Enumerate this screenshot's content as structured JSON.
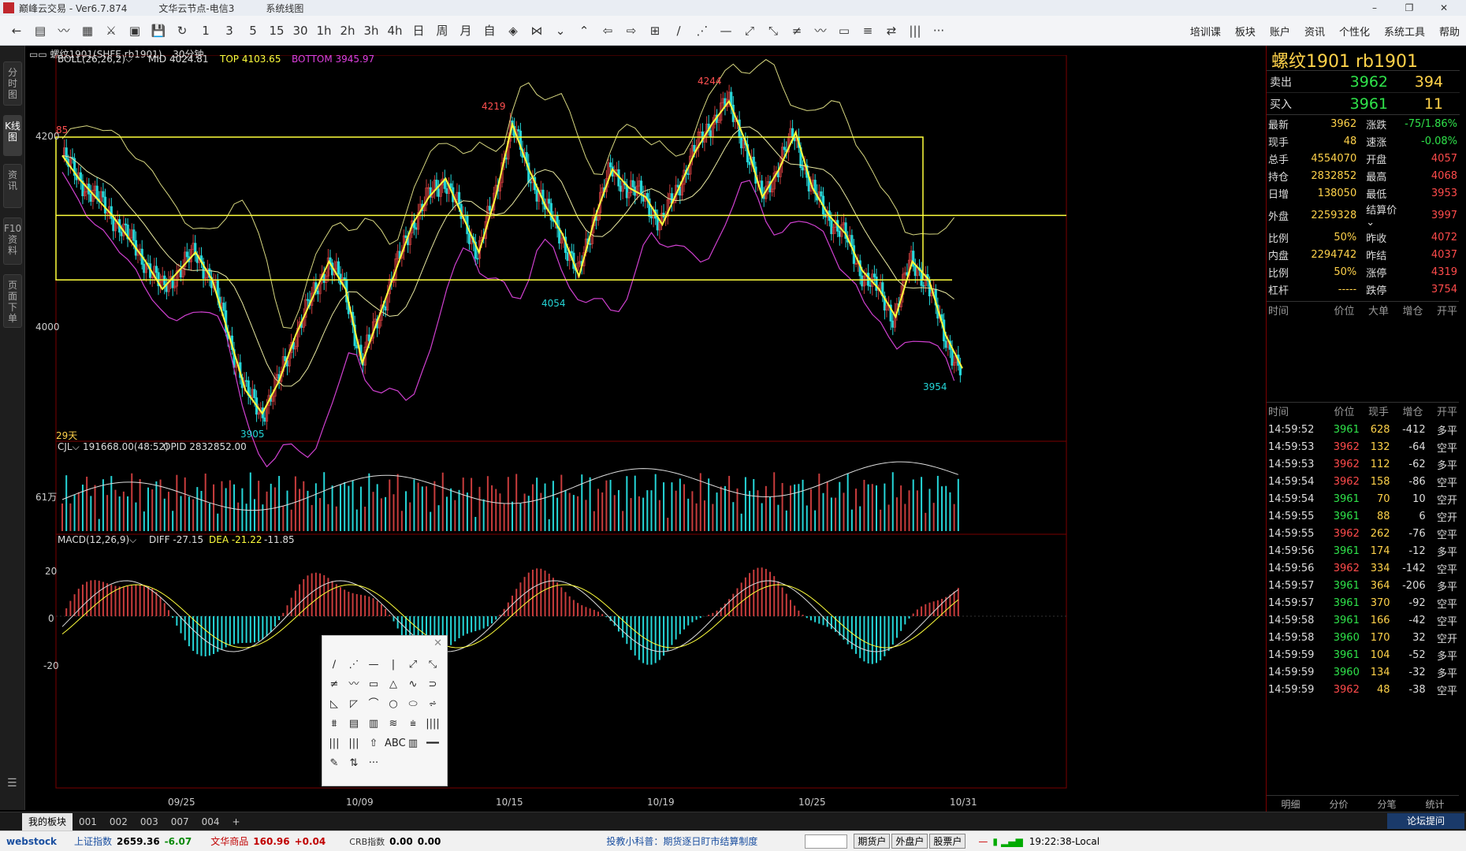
{
  "window": {
    "title": "巅峰云交易 - Ver6.7.874",
    "server": "文华云节点-电信3",
    "mode": "系统线图",
    "controls": [
      "–",
      "❐",
      "✕"
    ]
  },
  "toolbar": {
    "icons": [
      "←",
      "▤",
      "〰",
      "▦",
      "⚔",
      "▣",
      "💾",
      "↻",
      "1",
      "3",
      "5",
      "15",
      "30",
      "1h",
      "2h",
      "3h",
      "4h",
      "日",
      "周",
      "月",
      "自",
      "◈",
      "⋈",
      "⌄",
      "⌃",
      "⇦",
      "⇨",
      "⊞",
      "∕",
      "⋰",
      "—",
      "⤢",
      "⤡",
      "≠",
      "〰",
      "▭",
      "≡",
      "⇄",
      "|||",
      "···"
    ],
    "menu": [
      "培训课",
      "板块",
      "账户",
      "资讯",
      "个性化",
      "系统工具",
      "帮助"
    ]
  },
  "left_tabs": [
    "分时图",
    "K线图",
    "资讯",
    "F10资料",
    "页面下单"
  ],
  "chart": {
    "symbol_label": "▭▭ 螺纹1901(SHFE rb1901)",
    "period": "30分钟",
    "boll": {
      "label": "BOLL(26,26,2)⌵",
      "mid": "MID 4024.81",
      "top": "TOP 4103.65",
      "bottom": "BOTTOM 3945.97"
    },
    "y_labels": [
      "4200",
      "4000"
    ],
    "peak_labels": {
      "a": "85",
      "b": "4219",
      "c": "4244",
      "d": "4054",
      "e": "3905",
      "f": "3954",
      "days": "29天"
    },
    "vol": {
      "label": "CJL⌵",
      "value": "191668.00(48:52)",
      "opid": "OPID 2832852.00",
      "ylabel": "61万"
    },
    "macd": {
      "label": "MACD(12,26,9)⌵",
      "diff": "DIFF -27.15",
      "dea": "DEA -21.22",
      "m": "-11.85",
      "y_labels": [
        "20",
        "0",
        "-20"
      ]
    },
    "x_labels": [
      "09/25",
      "10/09",
      "10/15",
      "10/19",
      "10/25",
      "10/31"
    ]
  },
  "chart_data": {
    "type": "candlestick",
    "title": "螺纹1901(SHFE rb1901) 30分钟",
    "ylim": [
      3880,
      4270
    ],
    "series": [
      {
        "name": "price",
        "values": [
          4185,
          4160,
          4140,
          4120,
          4095,
          4070,
          4040,
          4060,
          4080,
          4050,
          3990,
          3930,
          3905,
          3940,
          3990,
          4030,
          4070,
          4040,
          3960,
          4010,
          4060,
          4110,
          4140,
          4160,
          4120,
          4080,
          4140,
          4219,
          4170,
          4130,
          4100,
          4054,
          4120,
          4170,
          4150,
          4140,
          4110,
          4150,
          4190,
          4220,
          4244,
          4200,
          4140,
          4170,
          4210,
          4150,
          4120,
          4100,
          4060,
          4040,
          4010,
          4070,
          4050,
          3990,
          3954
        ]
      }
    ],
    "annotations": {
      "high": 4244,
      "low": 3905,
      "last": 3954
    }
  },
  "quote": {
    "name": "螺纹1901  rb1901",
    "sell": {
      "label": "卖出",
      "price": "3962",
      "vol": "394"
    },
    "buy": {
      "label": "买入",
      "price": "3961",
      "vol": "11"
    },
    "rows": [
      [
        "最新",
        "3962",
        "涨跌",
        "-75/1.86%"
      ],
      [
        "现手",
        "48",
        "速涨",
        "-0.08%"
      ],
      [
        "总手",
        "4554070",
        "开盘",
        "4057"
      ],
      [
        "持仓",
        "2832852",
        "最高",
        "4068"
      ],
      [
        "日增",
        "138050",
        "最低",
        "3953"
      ],
      [
        "外盘",
        "2259328",
        "结算价⌄",
        "3997"
      ],
      [
        "比例",
        "50%",
        "昨收",
        "4072"
      ],
      [
        "内盘",
        "2294742",
        "昨结",
        "4037"
      ],
      [
        "比例",
        "50%",
        "涨停",
        "4319"
      ],
      [
        "杠杆",
        "-----",
        "跌停",
        "3754"
      ]
    ],
    "bigorder_header": [
      "时间",
      "价位",
      "大单",
      "增仓",
      "开平"
    ],
    "ticks_header": [
      "时间",
      "价位",
      "现手",
      "增仓",
      "开平"
    ],
    "ticks": [
      [
        "14:59:52",
        "3961",
        "628",
        "-412",
        "多平"
      ],
      [
        "14:59:53",
        "3962",
        "132",
        "-64",
        "空平"
      ],
      [
        "14:59:53",
        "3962",
        "112",
        "-62",
        "多平"
      ],
      [
        "14:59:54",
        "3962",
        "158",
        "-86",
        "空平"
      ],
      [
        "14:59:54",
        "3961",
        "70",
        "10",
        "空开"
      ],
      [
        "14:59:55",
        "3961",
        "88",
        "6",
        "空开"
      ],
      [
        "14:59:55",
        "3962",
        "262",
        "-76",
        "空平"
      ],
      [
        "14:59:56",
        "3961",
        "174",
        "-12",
        "多平"
      ],
      [
        "14:59:56",
        "3962",
        "334",
        "-142",
        "空平"
      ],
      [
        "14:59:57",
        "3961",
        "364",
        "-206",
        "多平"
      ],
      [
        "14:59:57",
        "3961",
        "370",
        "-92",
        "空平"
      ],
      [
        "14:59:58",
        "3961",
        "166",
        "-42",
        "空平"
      ],
      [
        "14:59:58",
        "3960",
        "170",
        "32",
        "空开"
      ],
      [
        "14:59:59",
        "3961",
        "104",
        "-52",
        "多平"
      ],
      [
        "14:59:59",
        "3960",
        "134",
        "-32",
        "多平"
      ],
      [
        "14:59:59",
        "3962",
        "48",
        "-38",
        "空平"
      ]
    ],
    "bottom_tabs": [
      "明细",
      "分价",
      "分笔",
      "统计"
    ]
  },
  "bottom_tabs": [
    "我的板块",
    "001",
    "002",
    "003",
    "007",
    "004",
    "+"
  ],
  "status": {
    "brand": "webstock",
    "index1_label": "上证指数",
    "index1_val": "2659.36",
    "index1_chg": "-6.07",
    "index2_label": "文华商品",
    "index2_val": "160.96",
    "index2_chg": "+0.04",
    "index3_label": "CRB指数",
    "index3_val": "0.00",
    "index3_chg": "0.00",
    "news": "投教小科普：期货逐日盯市结算制度",
    "buttons": [
      "期货户",
      "外盘户",
      "股票户"
    ],
    "time": "19:22:38-Local",
    "forum": "论坛提问"
  },
  "drawtools": {
    "icons": [
      "∕",
      "⋰",
      "—",
      "|",
      "⤢",
      "⤡",
      "≠",
      "〰",
      "▭",
      "△",
      "∿",
      "⊃",
      "◺",
      "◸",
      "⌒",
      "○",
      "⬭",
      "⩫",
      "⩩",
      "▤",
      "▥",
      "≋",
      "⩧",
      "||||",
      "|||",
      "|||",
      "⇧",
      "ABC",
      "▥",
      "━━",
      "✎",
      "⇅",
      "···"
    ],
    "close": "✕"
  },
  "colors": {
    "up": "#c83c3c",
    "down": "#25d6d8",
    "yellow": "#ffff3c",
    "magenta": "#d040d0",
    "boll": "#d8d880"
  }
}
